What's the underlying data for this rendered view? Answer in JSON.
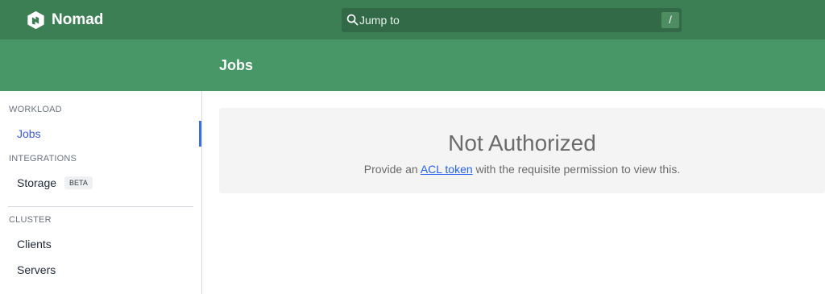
{
  "header": {
    "brand": "Nomad",
    "search": {
      "placeholder": "Jump to",
      "shortcut": "/"
    }
  },
  "page": {
    "title": "Jobs"
  },
  "sidebar": {
    "sections": [
      {
        "label": "WORKLOAD",
        "items": [
          {
            "label": "Jobs",
            "active": true
          }
        ]
      },
      {
        "label": "INTEGRATIONS",
        "items": [
          {
            "label": "Storage",
            "badge": "BETA"
          }
        ]
      },
      {
        "label": "CLUSTER",
        "items": [
          {
            "label": "Clients"
          },
          {
            "label": "Servers"
          }
        ]
      }
    ]
  },
  "empty_state": {
    "title": "Not Authorized",
    "message_before": "Provide an ",
    "link_text": "ACL token",
    "message_after": " with the requisite permission to view this."
  },
  "colors": {
    "topbar": "#3d7f55",
    "subheader": "#479866",
    "active_nav": "#3b5bdb",
    "link": "#2563eb"
  }
}
